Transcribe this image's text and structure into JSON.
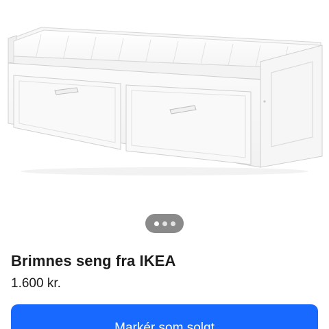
{
  "listing": {
    "title": "Brimnes seng fra IKEA",
    "price": "1.600 kr."
  },
  "carousel": {
    "dot_count": 3,
    "active_index": 0
  },
  "actions": {
    "mark_sold_label": "Markér som solgt"
  },
  "colors": {
    "primary": "#1769ff",
    "indicator_bg": "#8a8a8a",
    "text": "#1b1b1b"
  }
}
